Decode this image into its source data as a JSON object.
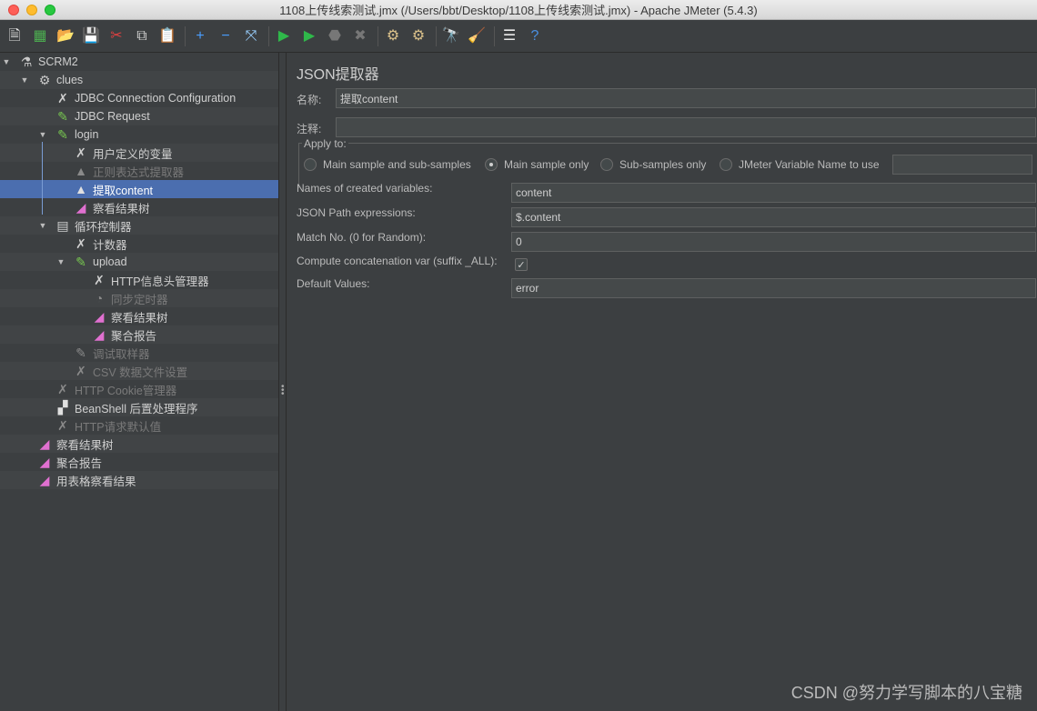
{
  "window": {
    "title": "1108上传线索测试.jmx (/Users/bbt/Desktop/1108上传线索测试.jmx) - Apache JMeter (5.4.3)"
  },
  "toolbar": {
    "buttons": [
      {
        "name": "new-icon",
        "glyph": "🗎",
        "color": "#e8e8e8"
      },
      {
        "name": "templates-icon",
        "glyph": "▦",
        "color": "#4caf50"
      },
      {
        "name": "open-icon",
        "glyph": "📂",
        "color": "#e8b84a"
      },
      {
        "name": "save-icon",
        "glyph": "💾",
        "color": "#d0d0d0"
      },
      {
        "name": "cut-icon",
        "glyph": "✂",
        "color": "#e04040"
      },
      {
        "name": "copy-icon",
        "glyph": "⧉",
        "color": "#d0d0d0"
      },
      {
        "name": "paste-icon",
        "glyph": "📋",
        "color": "#e8b84a"
      },
      {
        "name": "add-icon",
        "glyph": "+",
        "color": "#4a9eff"
      },
      {
        "name": "remove-icon",
        "glyph": "−",
        "color": "#4a9eff"
      },
      {
        "name": "toggle-icon",
        "glyph": "⤧",
        "color": "#9ad0ff"
      },
      {
        "name": "start-icon",
        "glyph": "▶",
        "color": "#2fb84a"
      },
      {
        "name": "start-no-pause-icon",
        "glyph": "▶",
        "color": "#2fb84a"
      },
      {
        "name": "stop-icon",
        "glyph": "⬣",
        "color": "#777777"
      },
      {
        "name": "shutdown-icon",
        "glyph": "✖",
        "color": "#777777"
      },
      {
        "name": "clear-icon",
        "glyph": "⚙",
        "color": "#d9c08a"
      },
      {
        "name": "clear-all-icon",
        "glyph": "⚙",
        "color": "#d9c08a"
      },
      {
        "name": "search-icon",
        "glyph": "🔭",
        "color": "#d0d0d0"
      },
      {
        "name": "reset-search-icon",
        "glyph": "🧹",
        "color": "#f0d040"
      },
      {
        "name": "function-helper-icon",
        "glyph": "☰",
        "color": "#e8e8e8"
      },
      {
        "name": "help-icon",
        "glyph": "?",
        "color": "#4a90e2"
      }
    ]
  },
  "tree": {
    "items": [
      {
        "label": "SCRM2",
        "depth": 0,
        "expanded": true,
        "icon": "test-plan-icon",
        "glyph": "⚗",
        "color": "#c8c8c8",
        "disabled": false,
        "selected": false
      },
      {
        "label": "clues",
        "depth": 1,
        "expanded": true,
        "icon": "thread-group-icon",
        "glyph": "⚙",
        "color": "#c8c8c8",
        "disabled": false,
        "selected": false
      },
      {
        "label": "JDBC Connection Configuration",
        "depth": 2,
        "icon": "config-element-icon",
        "glyph": "✗",
        "color": "#d0d0d0",
        "disabled": false,
        "selected": false
      },
      {
        "label": "JDBC Request",
        "depth": 2,
        "icon": "sampler-icon",
        "glyph": "✎",
        "color": "#78c850",
        "disabled": false,
        "selected": false
      },
      {
        "label": "login",
        "depth": 2,
        "expanded": true,
        "icon": "sampler-icon",
        "glyph": "✎",
        "color": "#78c850",
        "disabled": false,
        "selected": false
      },
      {
        "label": "用户定义的变量",
        "depth": 3,
        "icon": "config-element-icon",
        "glyph": "✗",
        "color": "#d0d0d0",
        "disabled": false,
        "selected": false
      },
      {
        "label": "正则表达式提取器",
        "depth": 3,
        "icon": "extractor-icon",
        "glyph": "▲",
        "color": "#8a8a8a",
        "disabled": true,
        "selected": false
      },
      {
        "label": "提取content",
        "depth": 3,
        "icon": "extractor-icon",
        "glyph": "▲",
        "color": "#e0e0e0",
        "disabled": false,
        "selected": true
      },
      {
        "label": "察看结果树",
        "depth": 3,
        "icon": "listener-icon",
        "glyph": "◢",
        "color": "#e070d0",
        "disabled": false,
        "selected": false
      },
      {
        "label": "循环控制器",
        "depth": 2,
        "expanded": true,
        "icon": "controller-icon",
        "glyph": "▤",
        "color": "#d0d0d0",
        "disabled": false,
        "selected": false
      },
      {
        "label": "计数器",
        "depth": 3,
        "icon": "config-element-icon",
        "glyph": "✗",
        "color": "#d0d0d0",
        "disabled": false,
        "selected": false
      },
      {
        "label": "upload",
        "depth": 3,
        "expanded": true,
        "icon": "sampler-icon",
        "glyph": "✎",
        "color": "#78c850",
        "disabled": false,
        "selected": false
      },
      {
        "label": "HTTP信息头管理器",
        "depth": 4,
        "icon": "config-element-icon",
        "glyph": "✗",
        "color": "#d0d0d0",
        "disabled": false,
        "selected": false
      },
      {
        "label": "同步定时器",
        "depth": 4,
        "icon": "timer-icon",
        "glyph": "◔",
        "color": "#8a8a8a",
        "disabled": true,
        "selected": false
      },
      {
        "label": "察看结果树",
        "depth": 4,
        "icon": "listener-icon",
        "glyph": "◢",
        "color": "#e070d0",
        "disabled": false,
        "selected": false
      },
      {
        "label": "聚合报告",
        "depth": 4,
        "icon": "listener-icon",
        "glyph": "◢",
        "color": "#e070d0",
        "disabled": false,
        "selected": false
      },
      {
        "label": "调试取样器",
        "depth": 3,
        "icon": "sampler-icon",
        "glyph": "✎",
        "color": "#8a8a8a",
        "disabled": true,
        "selected": false
      },
      {
        "label": "CSV 数据文件设置",
        "depth": 3,
        "icon": "config-element-icon",
        "glyph": "✗",
        "color": "#8a8a8a",
        "disabled": true,
        "selected": false
      },
      {
        "label": "HTTP Cookie管理器",
        "depth": 2,
        "icon": "config-element-icon",
        "glyph": "✗",
        "color": "#8a8a8a",
        "disabled": true,
        "selected": false
      },
      {
        "label": "BeanShell 后置处理程序",
        "depth": 2,
        "icon": "postprocessor-icon",
        "glyph": "▞",
        "color": "#e0e0e0",
        "disabled": false,
        "selected": false
      },
      {
        "label": "HTTP请求默认值",
        "depth": 2,
        "icon": "config-element-icon",
        "glyph": "✗",
        "color": "#8a8a8a",
        "disabled": true,
        "selected": false
      },
      {
        "label": "察看结果树",
        "depth": 1,
        "icon": "listener-icon",
        "glyph": "◢",
        "color": "#e070d0",
        "disabled": false,
        "selected": false
      },
      {
        "label": "聚合报告",
        "depth": 1,
        "icon": "listener-icon",
        "glyph": "◢",
        "color": "#e070d0",
        "disabled": false,
        "selected": false
      },
      {
        "label": "用表格察看结果",
        "depth": 1,
        "icon": "listener-icon",
        "glyph": "◢",
        "color": "#e070d0",
        "disabled": false,
        "selected": false
      }
    ]
  },
  "panel": {
    "title": "JSON提取器",
    "name_label": "名称:",
    "name_value": "提取content",
    "comment_label": "注释:",
    "comment_value": "",
    "apply_to": {
      "title": "Apply to:",
      "options": [
        {
          "label": "Main sample and sub-samples",
          "selected": false
        },
        {
          "label": "Main sample only",
          "selected": true
        },
        {
          "label": "Sub-samples only",
          "selected": false
        },
        {
          "label": "JMeter Variable Name to use",
          "selected": false
        }
      ],
      "variable_value": ""
    },
    "fields": {
      "names_label": "Names of created variables:",
      "names_value": "content",
      "path_label": "JSON Path expressions:",
      "path_value": "$.content",
      "match_label": "Match No. (0 for Random):",
      "match_value": "0",
      "concat_label": "Compute concatenation var (suffix _ALL):",
      "concat_checked": true,
      "default_label": "Default Values:",
      "default_value": "error"
    }
  },
  "watermark": "CSDN @努力学写脚本的八宝糖"
}
